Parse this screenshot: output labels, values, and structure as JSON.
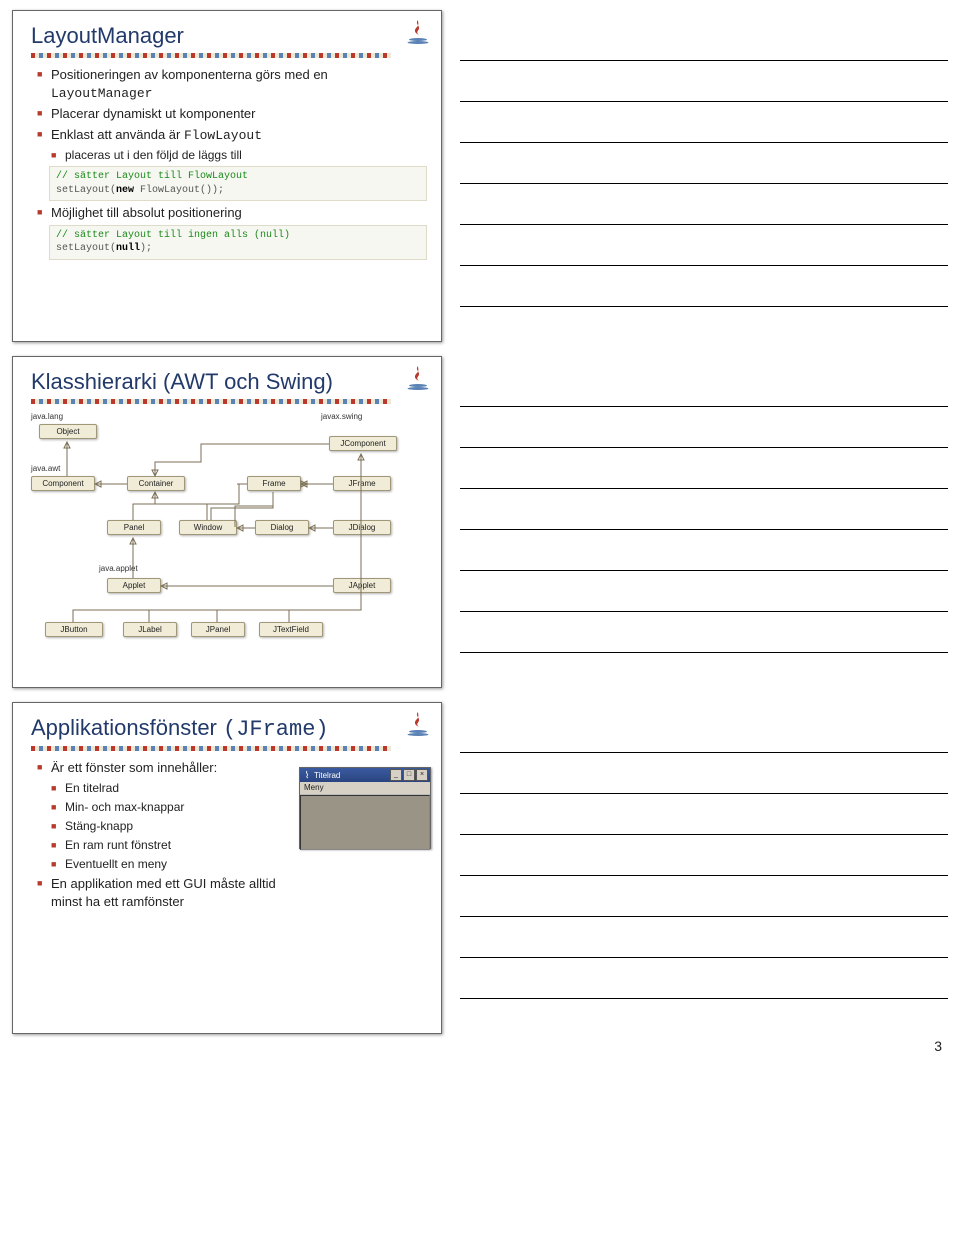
{
  "slide1": {
    "title": "LayoutManager",
    "b1_a": "Positioneringen av komponenterna görs med en ",
    "b1_b": "LayoutManager",
    "b2": "Placerar dynamiskt ut komponenter",
    "b3_a": "Enklast att använda är ",
    "b3_b": "FlowLayout",
    "b3s1": "placeras ut i den följd de läggs till",
    "code1": "// sätter Layout till FlowLayout\nsetLayout(new FlowLayout());",
    "b4": "Möjlighet till absolut positionering",
    "code2": "// sätter Layout till ingen alls (null)\nsetLayout(null);"
  },
  "slide2": {
    "title": "Klasshierarki (AWT och Swing)",
    "pkg_javalang": "java.lang",
    "pkg_javaxswing": "javax.swing",
    "pkg_javaawt": "java.awt",
    "pkg_javaapplet": "java.applet",
    "boxes": {
      "Object": "Object",
      "JComponent": "JComponent",
      "Component": "Component",
      "Container": "Container",
      "Frame": "Frame",
      "JFrame": "JFrame",
      "Panel": "Panel",
      "Window": "Window",
      "Dialog": "Dialog",
      "JDialog": "JDialog",
      "Applet": "Applet",
      "JApplet": "JApplet",
      "JButton": "JButton",
      "JLabel": "JLabel",
      "JPanel": "JPanel",
      "JTextField": "JTextField"
    }
  },
  "slide3": {
    "title_a": "Applikationsfönster ",
    "title_b": "(JFrame)",
    "b1": "Är ett fönster som innehåller:",
    "b1s1": "En titelrad",
    "b1s2": "Min- och max-knappar",
    "b1s3": "Stäng-knapp",
    "b1s4": "En ram runt fönstret",
    "b1s5": "Eventuellt en meny",
    "b2": "En applikation med ett GUI måste alltid minst ha ett ramfönster",
    "win_title": "Titelrad",
    "win_menu": "Meny"
  },
  "page_number": "3"
}
